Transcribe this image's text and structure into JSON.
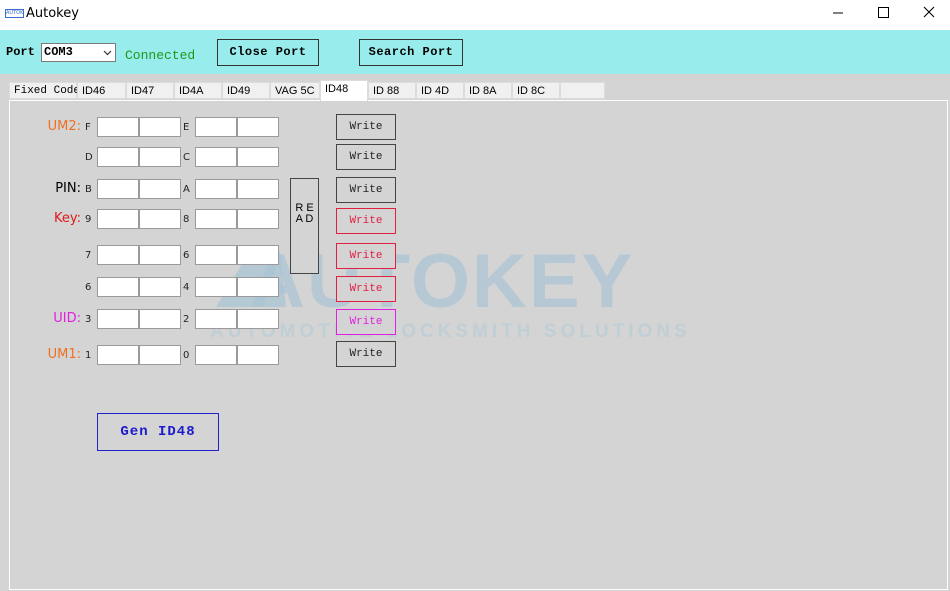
{
  "window": {
    "title": "Autokey",
    "logo_text": "AUTOKEY",
    "controls": {
      "minimize": "minimize-icon",
      "maximize": "maximize-icon",
      "close": "close-icon"
    }
  },
  "toolbar": {
    "port_label": "Port",
    "port_value": "COM3",
    "status": "Connected",
    "close_port": "Close Port",
    "search_port": "Search Port"
  },
  "tabs": [
    "Fixed Code",
    "ID46",
    "ID47",
    "ID4A",
    "ID49",
    "VAG 5C",
    "ID48",
    "ID 88",
    "ID 4D",
    "ID 8A",
    "ID 8C"
  ],
  "active_tab": "ID48",
  "watermark": {
    "brand": "AUTOKEY",
    "tagline": "AUTOMOTIVE LOCKSMITH SOLUTIONS"
  },
  "rows": [
    {
      "label": "UM2:",
      "label_color": "#f07020",
      "left": "F",
      "right": "E",
      "write": "Write",
      "write_color": "#222222"
    },
    {
      "label": "",
      "label_color": "#000000",
      "left": "D",
      "right": "C",
      "write": "Write",
      "write_color": "#222222"
    },
    {
      "label": "PIN:",
      "label_color": "#000000",
      "left": "B",
      "right": "A",
      "write": "Write",
      "write_color": "#222222"
    },
    {
      "label": "Key:",
      "label_color": "#e01818",
      "left": "9",
      "right": "8",
      "write": "Write",
      "write_color": "#e02040"
    },
    {
      "label": "",
      "label_color": "#000000",
      "left": "7",
      "right": "6",
      "write": "Write",
      "write_color": "#e02040"
    },
    {
      "label": "",
      "label_color": "#000000",
      "left": "6",
      "right": "4",
      "write": "Write",
      "write_color": "#e02040"
    },
    {
      "label": "UID:",
      "label_color": "#e020e0",
      "left": "3",
      "right": "2",
      "write": "Write",
      "write_color": "#e020e0"
    },
    {
      "label": "UM1:",
      "label_color": "#f07020",
      "left": "1",
      "right": "0",
      "write": "Write",
      "write_color": "#222222"
    }
  ],
  "read_button": "R E A D",
  "gen_button": "Gen  ID48",
  "colors": {
    "toolbar_bg": "#98ecec",
    "panel_bg": "#d4d4d4",
    "status": "#1c9a1c",
    "gen": "#1a1acc",
    "watermark": "#a8c4d4"
  }
}
